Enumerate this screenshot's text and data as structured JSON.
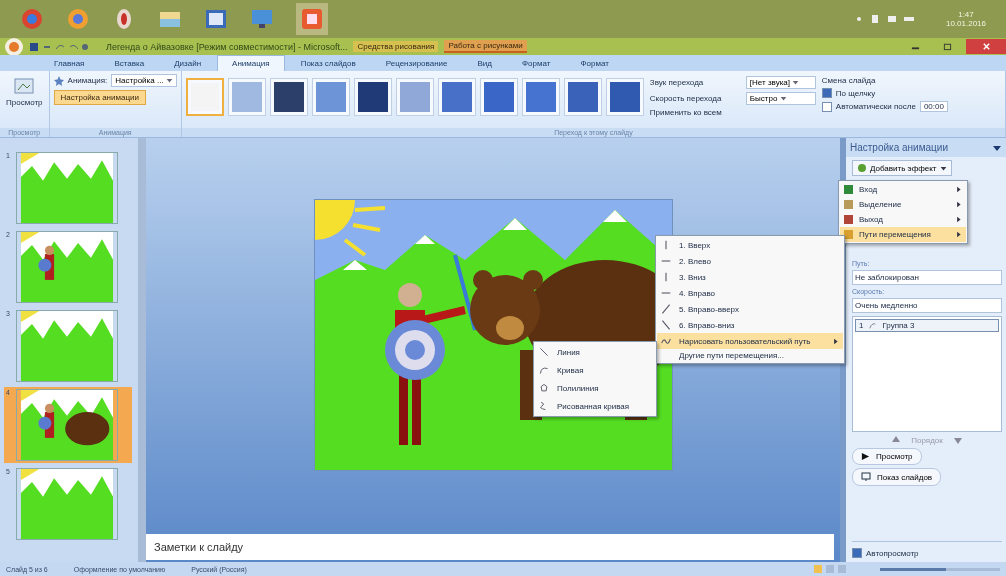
{
  "window": {
    "title": "Легенда о Айвазовке [Режим совместимости] - Microsoft...",
    "context_tabs": [
      "Средства рисования",
      "Работа с рисунками"
    ]
  },
  "tray": {
    "time": "1:47",
    "date": "10.01.2016"
  },
  "tabs": [
    {
      "label": "Главная",
      "selected": false
    },
    {
      "label": "Вставка",
      "selected": false
    },
    {
      "label": "Дизайн",
      "selected": false
    },
    {
      "label": "Анимация",
      "selected": true
    },
    {
      "label": "Показ слайдов",
      "selected": false
    },
    {
      "label": "Рецензирование",
      "selected": false
    },
    {
      "label": "Вид",
      "selected": false
    },
    {
      "label": "Формат",
      "selected": false
    },
    {
      "label": "Формат",
      "selected": false
    }
  ],
  "ribbon": {
    "preview_button": "Просмотр",
    "animation_label": "Анимация:",
    "animation_value": "Настройка ...",
    "custom_animation_button": "Настройка анимации",
    "groups": [
      "Просмотр",
      "Анимация",
      "Переход к этому слайду"
    ],
    "transitions": [
      {
        "selected": true
      },
      {
        "selected": false
      },
      {
        "selected": false
      },
      {
        "selected": false
      },
      {
        "selected": false
      },
      {
        "selected": false
      },
      {
        "selected": false
      },
      {
        "selected": false
      },
      {
        "selected": false
      },
      {
        "selected": false
      },
      {
        "selected": false
      }
    ],
    "sound_label": "Звук перехода",
    "sound_value": "[Нет звука]",
    "speed_label": "Скорость перехода",
    "speed_value": "Быстро",
    "apply_all": "Применить ко всем",
    "advance_title": "Смена слайда",
    "on_click": {
      "label": "По щелчку",
      "checked": true
    },
    "auto_after": {
      "label": "Автоматически после",
      "checked": false,
      "value": "00:00"
    }
  },
  "slides": [
    {
      "number": "1",
      "kind": "mountains",
      "selected": false
    },
    {
      "number": "2",
      "kind": "hunter",
      "selected": false
    },
    {
      "number": "3",
      "kind": "mountains",
      "selected": false
    },
    {
      "number": "4",
      "kind": "hunter-bear",
      "selected": true
    },
    {
      "number": "5",
      "kind": "mountains",
      "selected": false
    }
  ],
  "notes": {
    "placeholder": "Заметки к слайду"
  },
  "pane": {
    "title": "Настройка анимации",
    "add_effect": "Добавить эффект",
    "path_label": "Путь:",
    "path_value": "Не заблокирован",
    "speed_label": "Скорость:",
    "speed_value": "Очень медленно",
    "effects": [
      {
        "number": "1",
        "label": "Группа 3",
        "selected": true
      }
    ],
    "order_label": "Порядок",
    "play_button": "Просмотр",
    "slideshow_button": "Показ слайдов",
    "autopreview": {
      "label": "Автопросмотр",
      "checked": true
    }
  },
  "effect_menu": [
    {
      "label": "Вход",
      "selected": false,
      "color": "#2f8a3a"
    },
    {
      "label": "Выделение",
      "selected": false,
      "color": "#b89a5a"
    },
    {
      "label": "Выход",
      "selected": false,
      "color": "#b0463a"
    },
    {
      "label": "Пути перемещения",
      "selected": true,
      "color": "#d8a030"
    }
  ],
  "path_menu": [
    {
      "label": "1. Вверх",
      "kind": "up",
      "selected": false
    },
    {
      "label": "2. Влево",
      "kind": "left",
      "selected": false
    },
    {
      "label": "3. Вниз",
      "kind": "down",
      "selected": false
    },
    {
      "label": "4. Вправо",
      "kind": "right",
      "selected": false
    },
    {
      "label": "5. Вправо-вверх",
      "kind": "up-right",
      "selected": false
    },
    {
      "label": "6. Вправо-вниз",
      "kind": "down-right",
      "selected": false
    },
    {
      "label": "Нарисовать пользовательский путь",
      "kind": "submenu",
      "selected": true
    },
    {
      "label": "Другие пути перемещения...",
      "kind": "plain",
      "selected": false
    }
  ],
  "draw_menu": [
    {
      "label": "Линия",
      "kind": "line"
    },
    {
      "label": "Кривая",
      "kind": "curve"
    },
    {
      "label": "Полилиния",
      "kind": "polygon"
    },
    {
      "label": "Рисованная кривая",
      "kind": "scribble"
    }
  ],
  "zoom": {
    "level": 0.55
  },
  "status": {
    "slide": "Слайд 5 из 6",
    "theme": "Оформление по умолчанию",
    "language": "Русский (Россия)"
  }
}
